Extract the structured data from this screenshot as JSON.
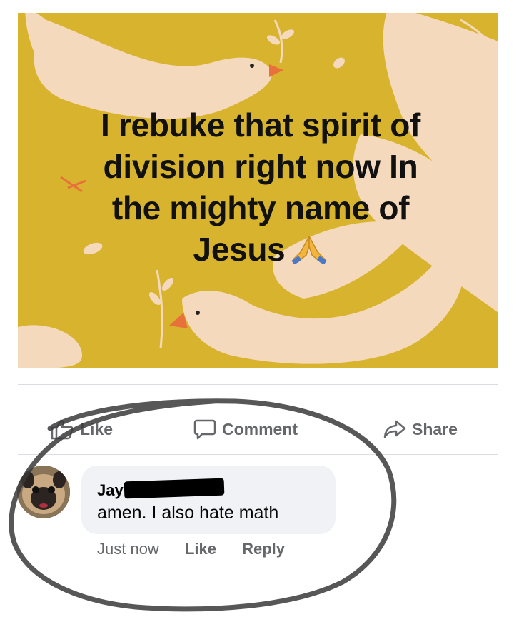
{
  "post": {
    "text_lines": [
      "I rebuke that spirit of",
      "division right now In",
      "the mighty name of",
      "Jesus"
    ],
    "emoji": "folded-hands-icon"
  },
  "actions": {
    "like": "Like",
    "comment": "Comment",
    "share": "Share"
  },
  "comment": {
    "author": "Jay",
    "text": "amen. I also hate math",
    "time": "Just now",
    "like": "Like",
    "reply": "Reply"
  },
  "colors": {
    "image_background": "#d8b42e",
    "dove": "#f4d9bc",
    "text_gray": "#65676b",
    "bubble": "#f0f2f5"
  }
}
